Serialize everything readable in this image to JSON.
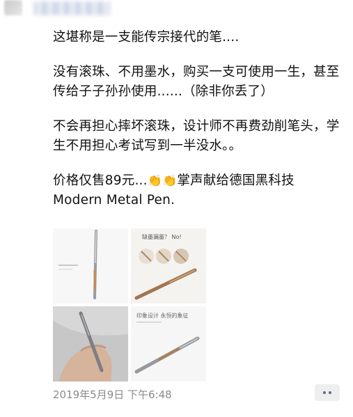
{
  "post": {
    "paragraphs": [
      "这堪称是一支能传宗接代的笔....",
      "没有滚珠、不用墨水，购买一支可使用一生，甚至传给子子孙孙使用......（除非你丢了）",
      "不会再担心摔坏滚珠，设计师不再费劲削笔头，学生不用担心考试写到一半没水。。",
      "价格仅售89元...",
      "掌声献给德国黑科技Modern Metal Pen."
    ],
    "clap_emoji": "👏👏"
  },
  "images": {
    "img2_title": "缺墨漏墨？ No!",
    "img4_caption": "印象设计 永恒的象征"
  },
  "footer": {
    "timestamp": "2019年5月9日 下午6:48"
  },
  "colors": {
    "text": "#111111",
    "timestamp": "#8a8a8a",
    "more_dots": "#5e6b87"
  }
}
